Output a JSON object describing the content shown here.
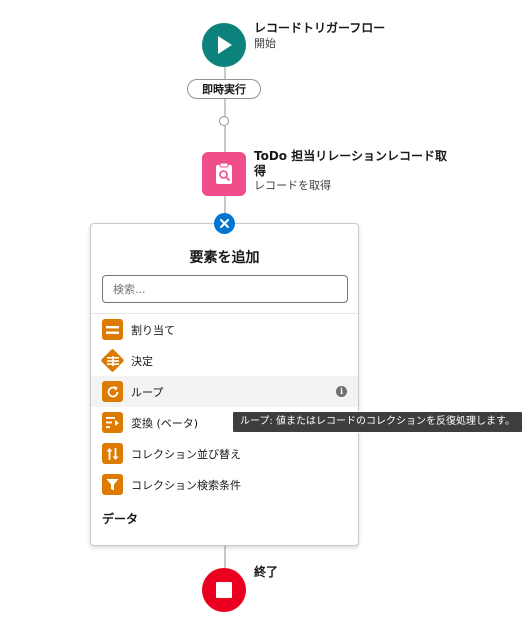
{
  "start": {
    "title": "レコードトリガーフロー",
    "subtitle": "開始"
  },
  "run_pill": {
    "label": "即時実行"
  },
  "get_records": {
    "title_line1": "ToDo 担当リレーションレコード取",
    "title_line2": "得",
    "subtitle": "レコードを取得"
  },
  "add_element_panel": {
    "title": "要素を追加",
    "search": {
      "placeholder": "検索...",
      "value": ""
    },
    "items": [
      {
        "label": "割り当て",
        "icon": "assignment-icon"
      },
      {
        "label": "決定",
        "icon": "decision-icon"
      },
      {
        "label": "ループ",
        "icon": "loop-icon",
        "hovered": true
      },
      {
        "label": "変換 (ベータ)",
        "icon": "transform-icon"
      },
      {
        "label": "コレクション並び替え",
        "icon": "sort-icon"
      },
      {
        "label": "コレクション検索条件",
        "icon": "filter-icon"
      }
    ],
    "section_header": "データ"
  },
  "tooltip": {
    "text": "ループ: 値またはレコードのコレクションを反復処理します。"
  },
  "end": {
    "title": "終了"
  },
  "colors": {
    "start": "#0b827c",
    "get_records": "#f04d8b",
    "element_icon": "#dd7a01",
    "close_button": "#0176d3",
    "end": "#ea001e"
  }
}
